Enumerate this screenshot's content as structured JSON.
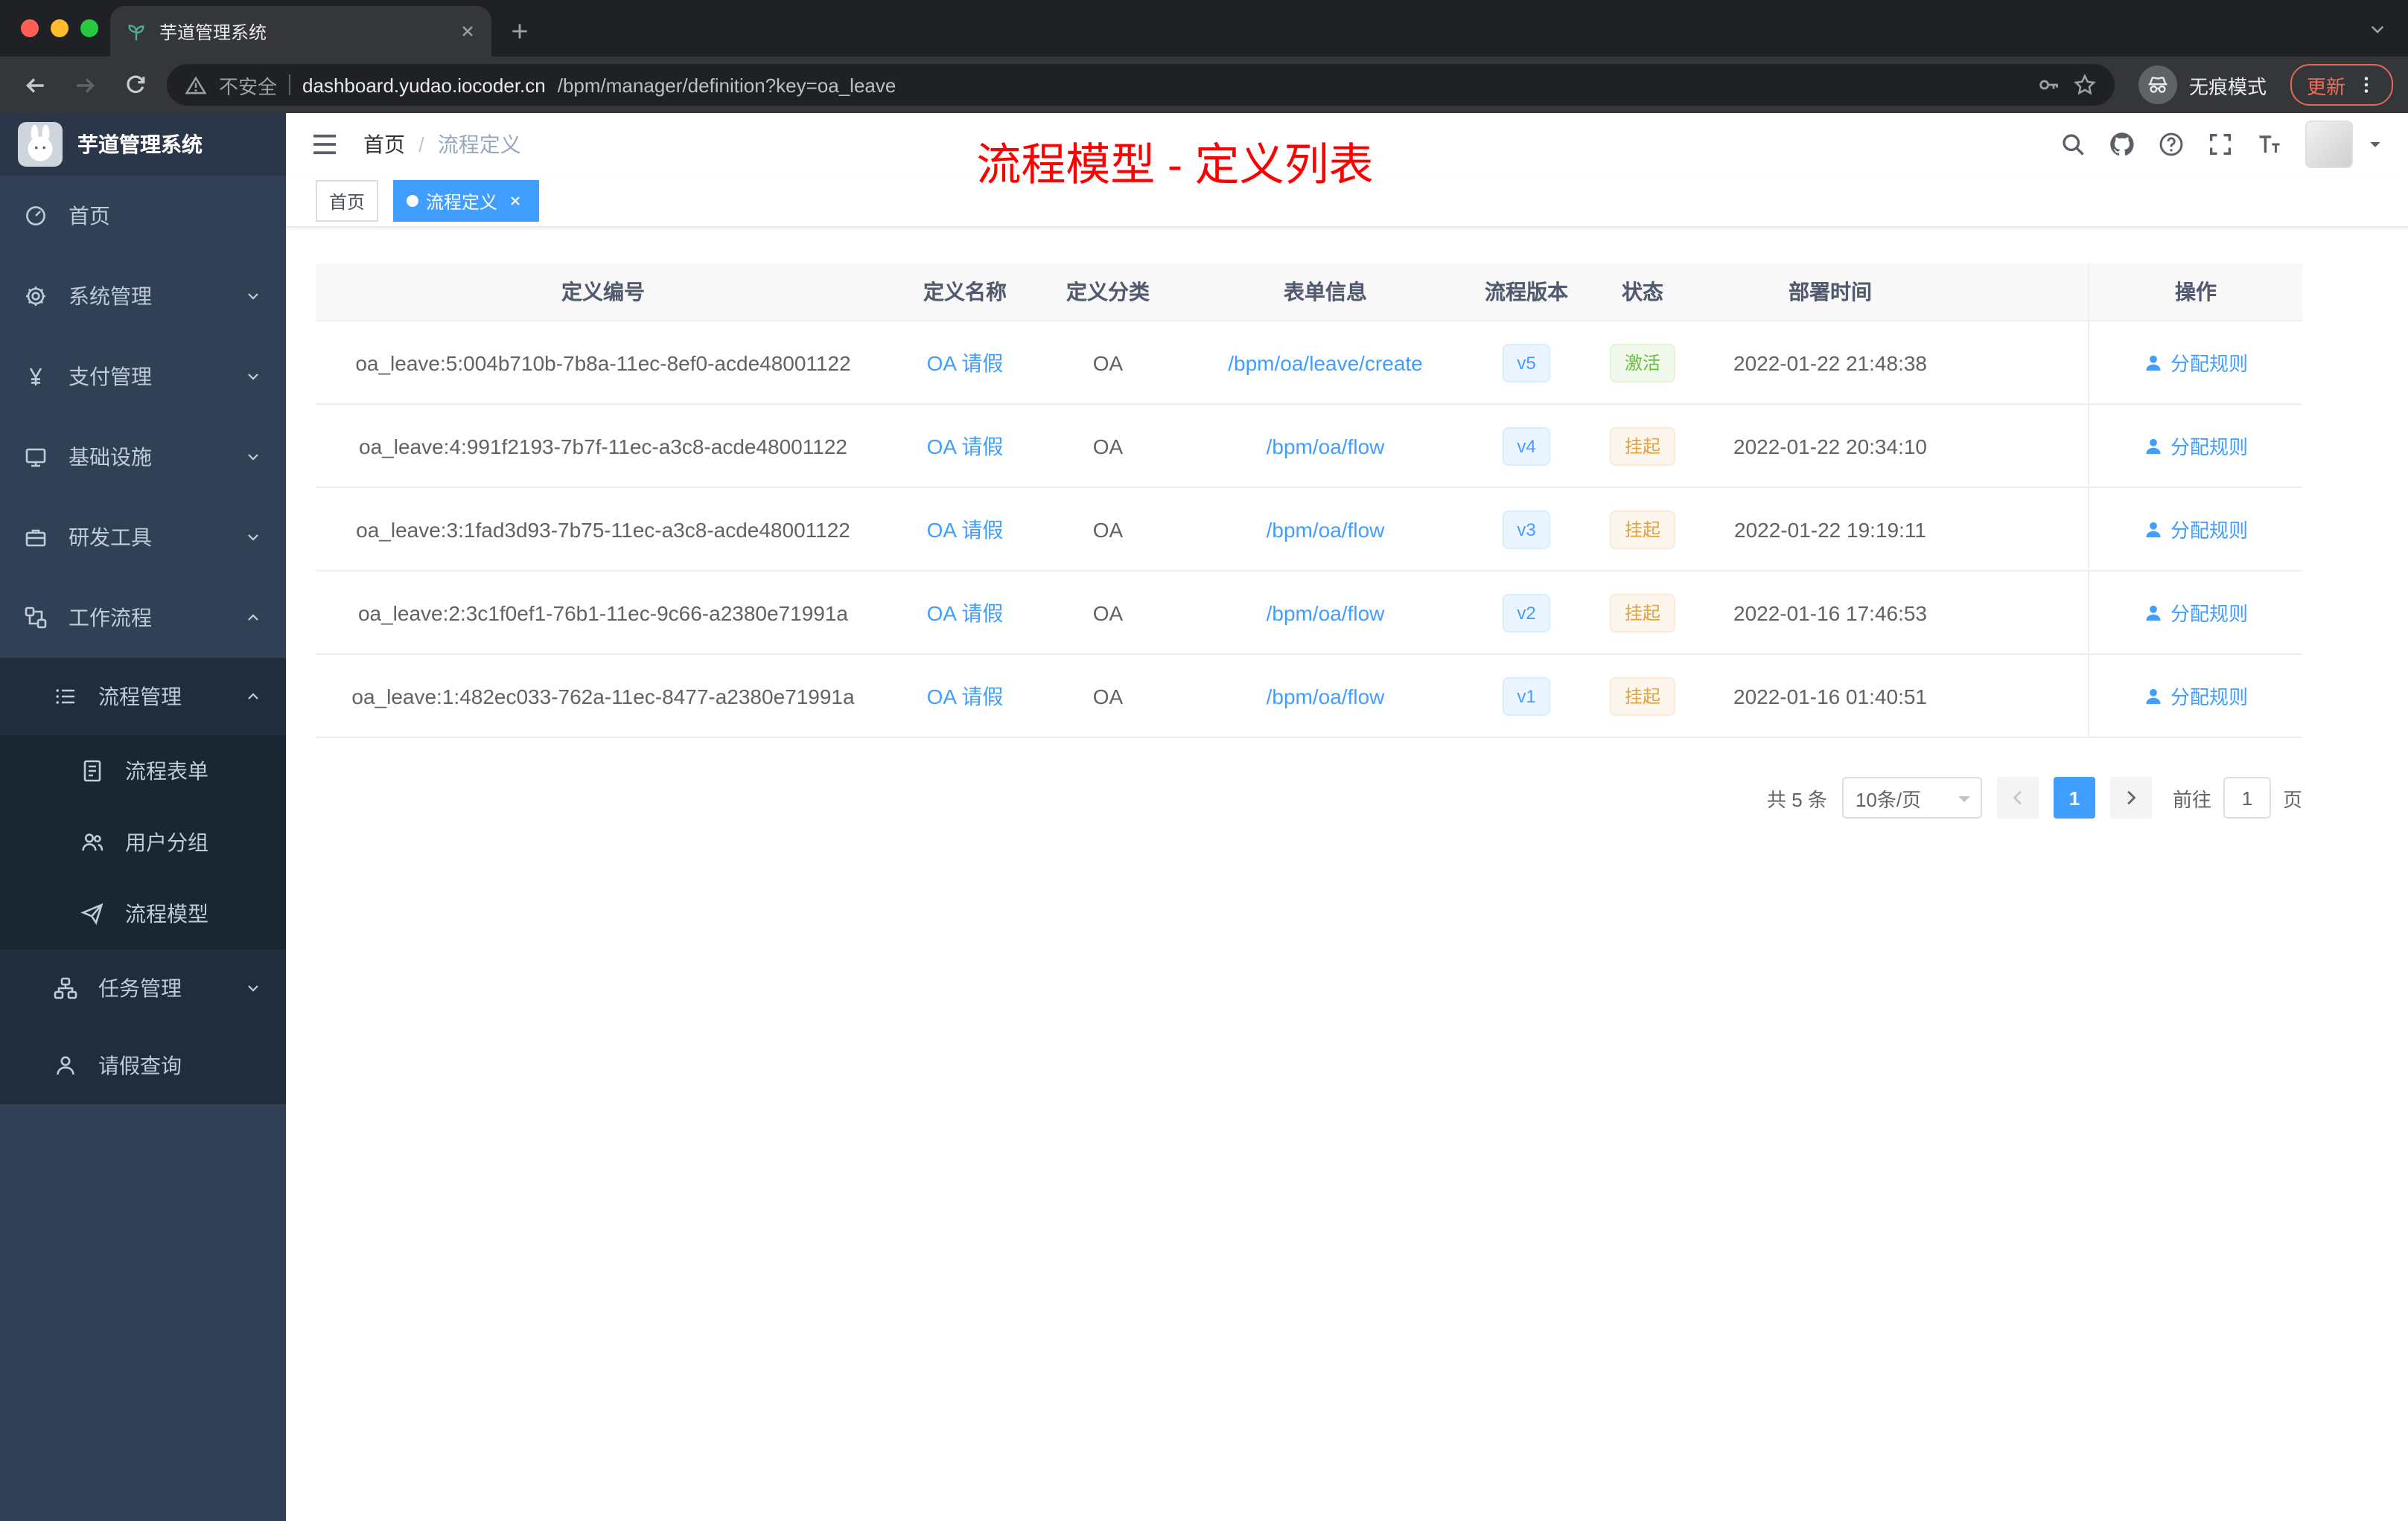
{
  "theme": {
    "accent": "#409eff",
    "success_color": "#67c23a",
    "warning_color": "#e6a23c",
    "annotation_color": "#ff0000",
    "sidebar_bg": "#304156",
    "submenu_bg": "#1f2d3d"
  },
  "browser": {
    "tab_title": "芋道管理系统",
    "address": {
      "security_label": "不安全",
      "host": "dashboard.yudao.iocoder.cn",
      "path": "/bpm/manager/definition?key=oa_leave"
    },
    "incognito_label": "无痕模式",
    "update_label": "更新"
  },
  "sidebar": {
    "logo_title": "芋道管理系统",
    "items": [
      {
        "key": "home",
        "label": "首页",
        "icon": "dashboard",
        "level": 1
      },
      {
        "key": "system",
        "label": "系统管理",
        "icon": "gear",
        "level": 1,
        "chevron": "down"
      },
      {
        "key": "payment",
        "label": "支付管理",
        "icon": "yen",
        "level": 1,
        "chevron": "down"
      },
      {
        "key": "infra",
        "label": "基础设施",
        "icon": "monitor",
        "level": 1,
        "chevron": "down"
      },
      {
        "key": "devtools",
        "label": "研发工具",
        "icon": "briefcase",
        "level": 1,
        "chevron": "down"
      },
      {
        "key": "workflow",
        "label": "工作流程",
        "icon": "workflow",
        "level": 1,
        "chevron": "up"
      },
      {
        "key": "process-manage",
        "label": "流程管理",
        "icon": "list",
        "level": 2,
        "chevron": "up"
      },
      {
        "key": "process-form",
        "label": "流程表单",
        "icon": "form",
        "level": 3
      },
      {
        "key": "user-group",
        "label": "用户分组",
        "icon": "users",
        "level": 3
      },
      {
        "key": "process-model",
        "label": "流程模型",
        "icon": "plane",
        "level": 3
      },
      {
        "key": "task-manage",
        "label": "任务管理",
        "icon": "org",
        "level": 2,
        "chevron": "down"
      },
      {
        "key": "leave-query",
        "label": "请假查询",
        "icon": "user",
        "level": 2
      }
    ]
  },
  "header": {
    "breadcrumb": [
      "首页",
      "流程定义"
    ],
    "annotation": "流程模型 - 定义列表"
  },
  "tags": [
    {
      "label": "首页",
      "active": false,
      "closable": false
    },
    {
      "label": "流程定义",
      "active": true,
      "closable": true
    }
  ],
  "table": {
    "columns": [
      "定义编号",
      "定义名称",
      "定义分类",
      "表单信息",
      "流程版本",
      "状态",
      "部署时间",
      "操作"
    ],
    "rows": [
      {
        "id": "oa_leave:5:004b710b-7b8a-11ec-8ef0-acde48001122",
        "name": "OA 请假",
        "category": "OA",
        "form": "/bpm/oa/leave/create",
        "version": "v5",
        "status": "激活",
        "status_type": "success",
        "time": "2022-01-22 21:48:38",
        "action": "分配规则"
      },
      {
        "id": "oa_leave:4:991f2193-7b7f-11ec-a3c8-acde48001122",
        "name": "OA 请假",
        "category": "OA",
        "form": "/bpm/oa/flow",
        "version": "v4",
        "status": "挂起",
        "status_type": "warning",
        "time": "2022-01-22 20:34:10",
        "action": "分配规则"
      },
      {
        "id": "oa_leave:3:1fad3d93-7b75-11ec-a3c8-acde48001122",
        "name": "OA 请假",
        "category": "OA",
        "form": "/bpm/oa/flow",
        "version": "v3",
        "status": "挂起",
        "status_type": "warning",
        "time": "2022-01-22 19:19:11",
        "action": "分配规则"
      },
      {
        "id": "oa_leave:2:3c1f0ef1-76b1-11ec-9c66-a2380e71991a",
        "name": "OA 请假",
        "category": "OA",
        "form": "/bpm/oa/flow",
        "version": "v2",
        "status": "挂起",
        "status_type": "warning",
        "time": "2022-01-16 17:46:53",
        "action": "分配规则"
      },
      {
        "id": "oa_leave:1:482ec033-762a-11ec-8477-a2380e71991a",
        "name": "OA 请假",
        "category": "OA",
        "form": "/bpm/oa/flow",
        "version": "v1",
        "status": "挂起",
        "status_type": "warning",
        "time": "2022-01-16 01:40:51",
        "action": "分配规则"
      }
    ]
  },
  "pagination": {
    "total": "共 5 条",
    "page_size": "10条/页",
    "current": "1",
    "goto_label": "前往",
    "goto_value": "1",
    "unit_label": "页"
  }
}
